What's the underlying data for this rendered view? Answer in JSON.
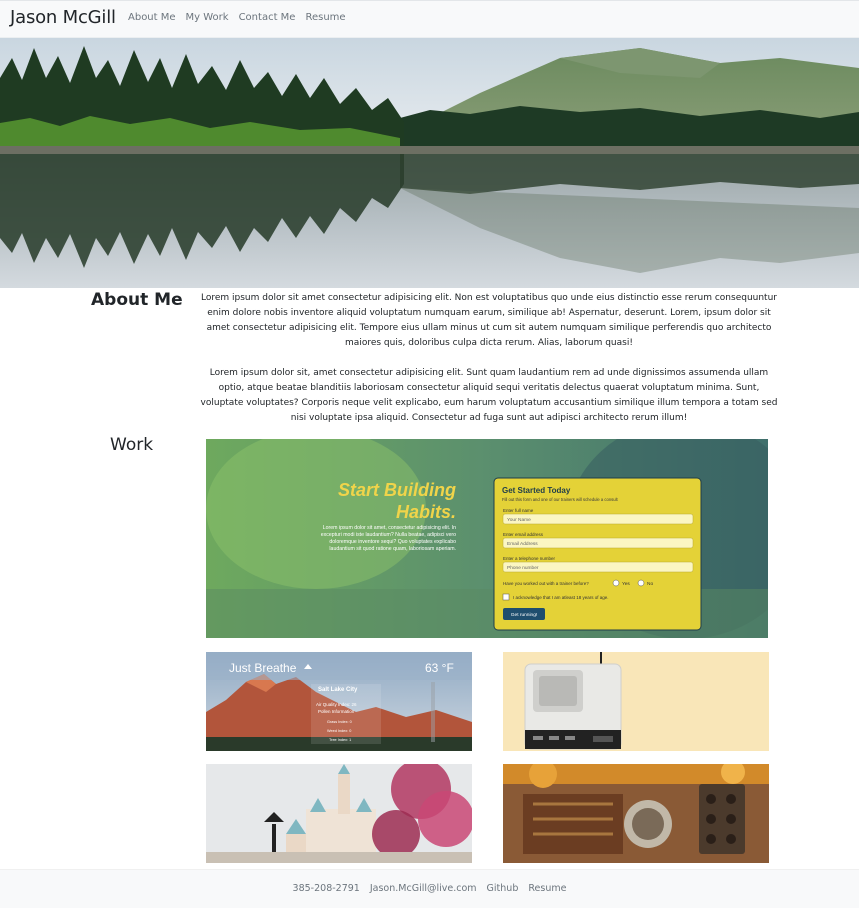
{
  "navbar": {
    "brand": "Jason McGill",
    "links": [
      "About Me",
      "My Work",
      "Contact Me",
      "Resume"
    ]
  },
  "about": {
    "title": "About Me",
    "paragraph1": "Lorem ipsum dolor sit amet consectetur adipisicing elit. Non est voluptatibus quo unde eius distinctio esse rerum consequuntur enim dolore nobis inventore aliquid voluptatum numquam earum, similique ab! Aspernatur, deserunt. Lorem, ipsum dolor sit amet consectetur adipisicing elit. Tempore eius ullam minus ut cum sit autem numquam similique perferendis quo architecto maiores quis, doloribus culpa dicta rerum. Alias, laborum quasi!",
    "paragraph2": "Lorem ipsum dolor sit, amet consectetur adipisicing elit. Sunt quam laudantium rem ad unde dignissimos assumenda ullam optio, atque beatae blanditiis laboriosam consectetur aliquid sequi veritatis delectus quaerat voluptatum minima. Sunt, voluptate voluptates? Corporis neque velit explicabo, eum harum voluptatum accusantium similique illum tempora a totam sed nisi voluptate ipsa aliquid. Consectetur ad fuga sunt aut adipisci architecto rerum illum!"
  },
  "work": {
    "title": "Work",
    "featured": {
      "headline_line1": "Start Building",
      "headline_line2": "Habits.",
      "blurb": [
        "Lorem ipsum dolor sit amet, consectetur adipisicing elit. In",
        "excepturi modi iste laudantium? Nulla beatae, adipisci vero",
        "doloremque inventore sequi? Quo voluptates explicabo",
        "laudantium sit quod ratione quam, laboriosam aperiam."
      ],
      "form_title": "Get Started Today",
      "form_subtitle": "Fill out this form and one of our trainers will schedule a consult",
      "name_label": "Enter full name",
      "name_placeholder": "Your Name",
      "email_label": "Enter email address",
      "email_placeholder": "Email Address",
      "phone_label": "Enter a telephone number",
      "phone_placeholder": "Phone number",
      "trainer_question": "Have you worked out with a trainer before?",
      "yes_label": "Yes",
      "no_label": "No",
      "age_check_label": "I acknowledge that I am atleast 18 years of age.",
      "submit_label": "Get running!"
    },
    "weather": {
      "title": "Just Breathe",
      "temperature": "63 °F",
      "city": "Salt Lake City",
      "air_quality": "Air Quality Index: 26",
      "pollen": "Pollen Information",
      "grass": "Grass Index: 0",
      "weed": "Weed Index: 0",
      "tree": "Tree Index: 1"
    }
  },
  "footer": {
    "links": [
      "385-208-2791",
      "Jason.McGill@live.com",
      "Github",
      "Resume"
    ]
  },
  "colors": {
    "navbar_bg": "#f8f9fa",
    "link_gray": "#6c757d",
    "form_yellow": "#e4d237",
    "form_border": "#1f3d4a",
    "headline_yellow": "#f0d44a"
  }
}
